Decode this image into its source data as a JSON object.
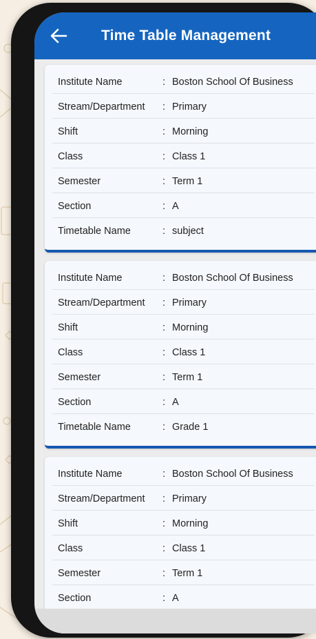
{
  "appbar": {
    "title": "Time Table Management",
    "back_icon": "arrow-left-icon"
  },
  "labels": {
    "institute": "Institute Name",
    "stream": "Stream/Department",
    "shift": "Shift",
    "class": "Class",
    "semester": "Semester",
    "section": "Section",
    "timetable": "Timetable Name",
    "colon": ":"
  },
  "cards": [
    {
      "institute": "Boston School Of Business",
      "stream": "Primary",
      "shift": "Morning",
      "class": "Class 1",
      "semester": "Term 1",
      "section": "A",
      "timetable": "subject"
    },
    {
      "institute": "Boston School Of Business",
      "stream": "Primary",
      "shift": "Morning",
      "class": "Class 1",
      "semester": "Term 1",
      "section": "A",
      "timetable": "Grade 1"
    },
    {
      "institute": "Boston School Of Business",
      "stream": "Primary",
      "shift": "Morning",
      "class": "Class 1",
      "semester": "Term 1",
      "section": "A"
    }
  ],
  "colors": {
    "appbar": "#1565c0",
    "card_accent": "#1558b0",
    "background": "#f6eee2"
  }
}
